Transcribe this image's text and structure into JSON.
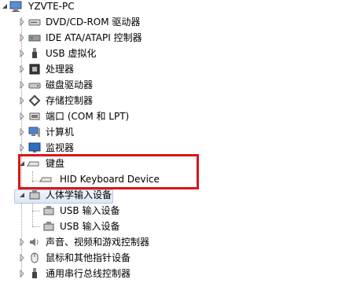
{
  "tree": {
    "root": "YZVTE-PC",
    "categories": [
      {
        "label": "DVD/CD-ROM 驱动器",
        "icon": "dvd-drive-icon"
      },
      {
        "label": "IDE ATA/ATAPI 控制器",
        "icon": "ide-controller-icon"
      },
      {
        "label": "USB 虚拟化",
        "icon": "usb-icon"
      },
      {
        "label": "处理器",
        "icon": "processor-icon"
      },
      {
        "label": "磁盘驱动器",
        "icon": "disk-drive-icon"
      },
      {
        "label": "存储控制器",
        "icon": "storage-controller-icon"
      },
      {
        "label": "端口 (COM 和 LPT)",
        "icon": "port-icon"
      },
      {
        "label": "计算机",
        "icon": "computer-icon"
      },
      {
        "label": "监视器",
        "icon": "monitor-icon"
      },
      {
        "label": "键盘",
        "icon": "keyboard-icon"
      },
      {
        "label": "人体学输入设备",
        "icon": "hid-icon"
      },
      {
        "label": "声音、视频和游戏控制器",
        "icon": "sound-icon"
      },
      {
        "label": "鼠标和其他指针设备",
        "icon": "mouse-icon"
      },
      {
        "label": "通用串行总线控制器",
        "icon": "usb-controller-icon"
      }
    ],
    "keyboard_children": [
      "HID Keyboard Device"
    ],
    "hid_children": [
      "USB 输入设备",
      "USB 输入设备"
    ]
  },
  "colors": {
    "highlight_border": "#d8161a",
    "selection": "#dce7f5"
  }
}
